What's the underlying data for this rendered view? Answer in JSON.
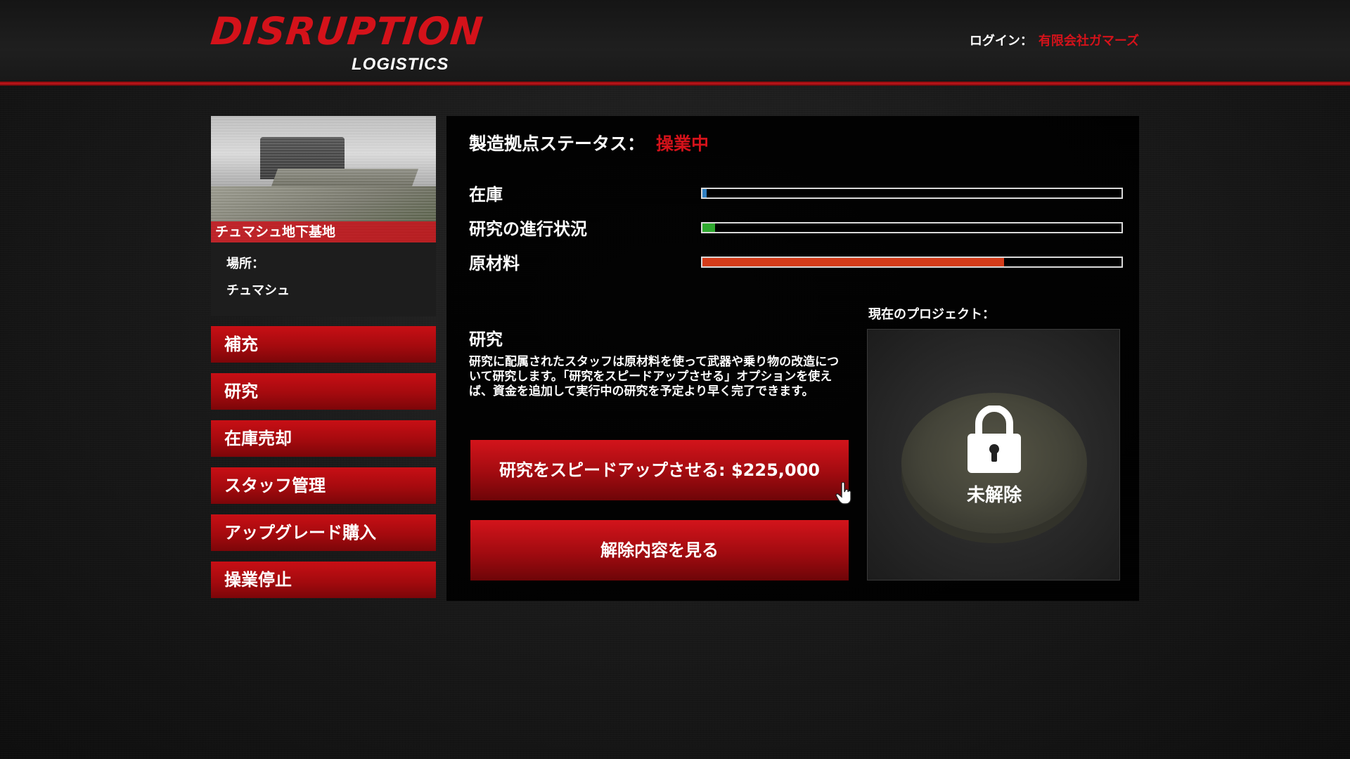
{
  "header": {
    "logo_main": "DISRUPTION",
    "logo_sub": "LOGISTICS",
    "login_label": "ログイン：",
    "login_user": "有限会社ガマーズ"
  },
  "base": {
    "name": "チュマシュ地下基地",
    "location_label": "場所：",
    "location_value": "チュマシュ"
  },
  "menu": [
    {
      "label": "補充"
    },
    {
      "label": "研究"
    },
    {
      "label": "在庫売却"
    },
    {
      "label": "スタッフ管理"
    },
    {
      "label": "アップグレード購入"
    },
    {
      "label": "操業停止"
    }
  ],
  "status": {
    "label": "製造拠点ステータス：",
    "value": "操業中"
  },
  "stats": [
    {
      "label": "在庫",
      "fill": 0.01,
      "color": "#2f7fc1"
    },
    {
      "label": "研究の進行状況",
      "fill": 0.03,
      "color": "#2fa82f"
    },
    {
      "label": "原材料",
      "fill": 0.72,
      "color": "#d43c1a"
    }
  ],
  "research": {
    "title": "研究",
    "description": "研究に配属されたスタッフは原材料を使って武器や乗り物の改造について研究します。「研究をスピードアップさせる」オプションを使えば、資金を追加して実行中の研究を予定より早く完了できます。",
    "speedup_button": "研究をスピードアップさせる: $225,000",
    "view_unlocks_button": "解除内容を見る"
  },
  "project": {
    "label": "現在のプロジェクト：",
    "status": "未解除"
  },
  "colors": {
    "accent": "#d4121a",
    "menu_red": "#b00c11"
  }
}
